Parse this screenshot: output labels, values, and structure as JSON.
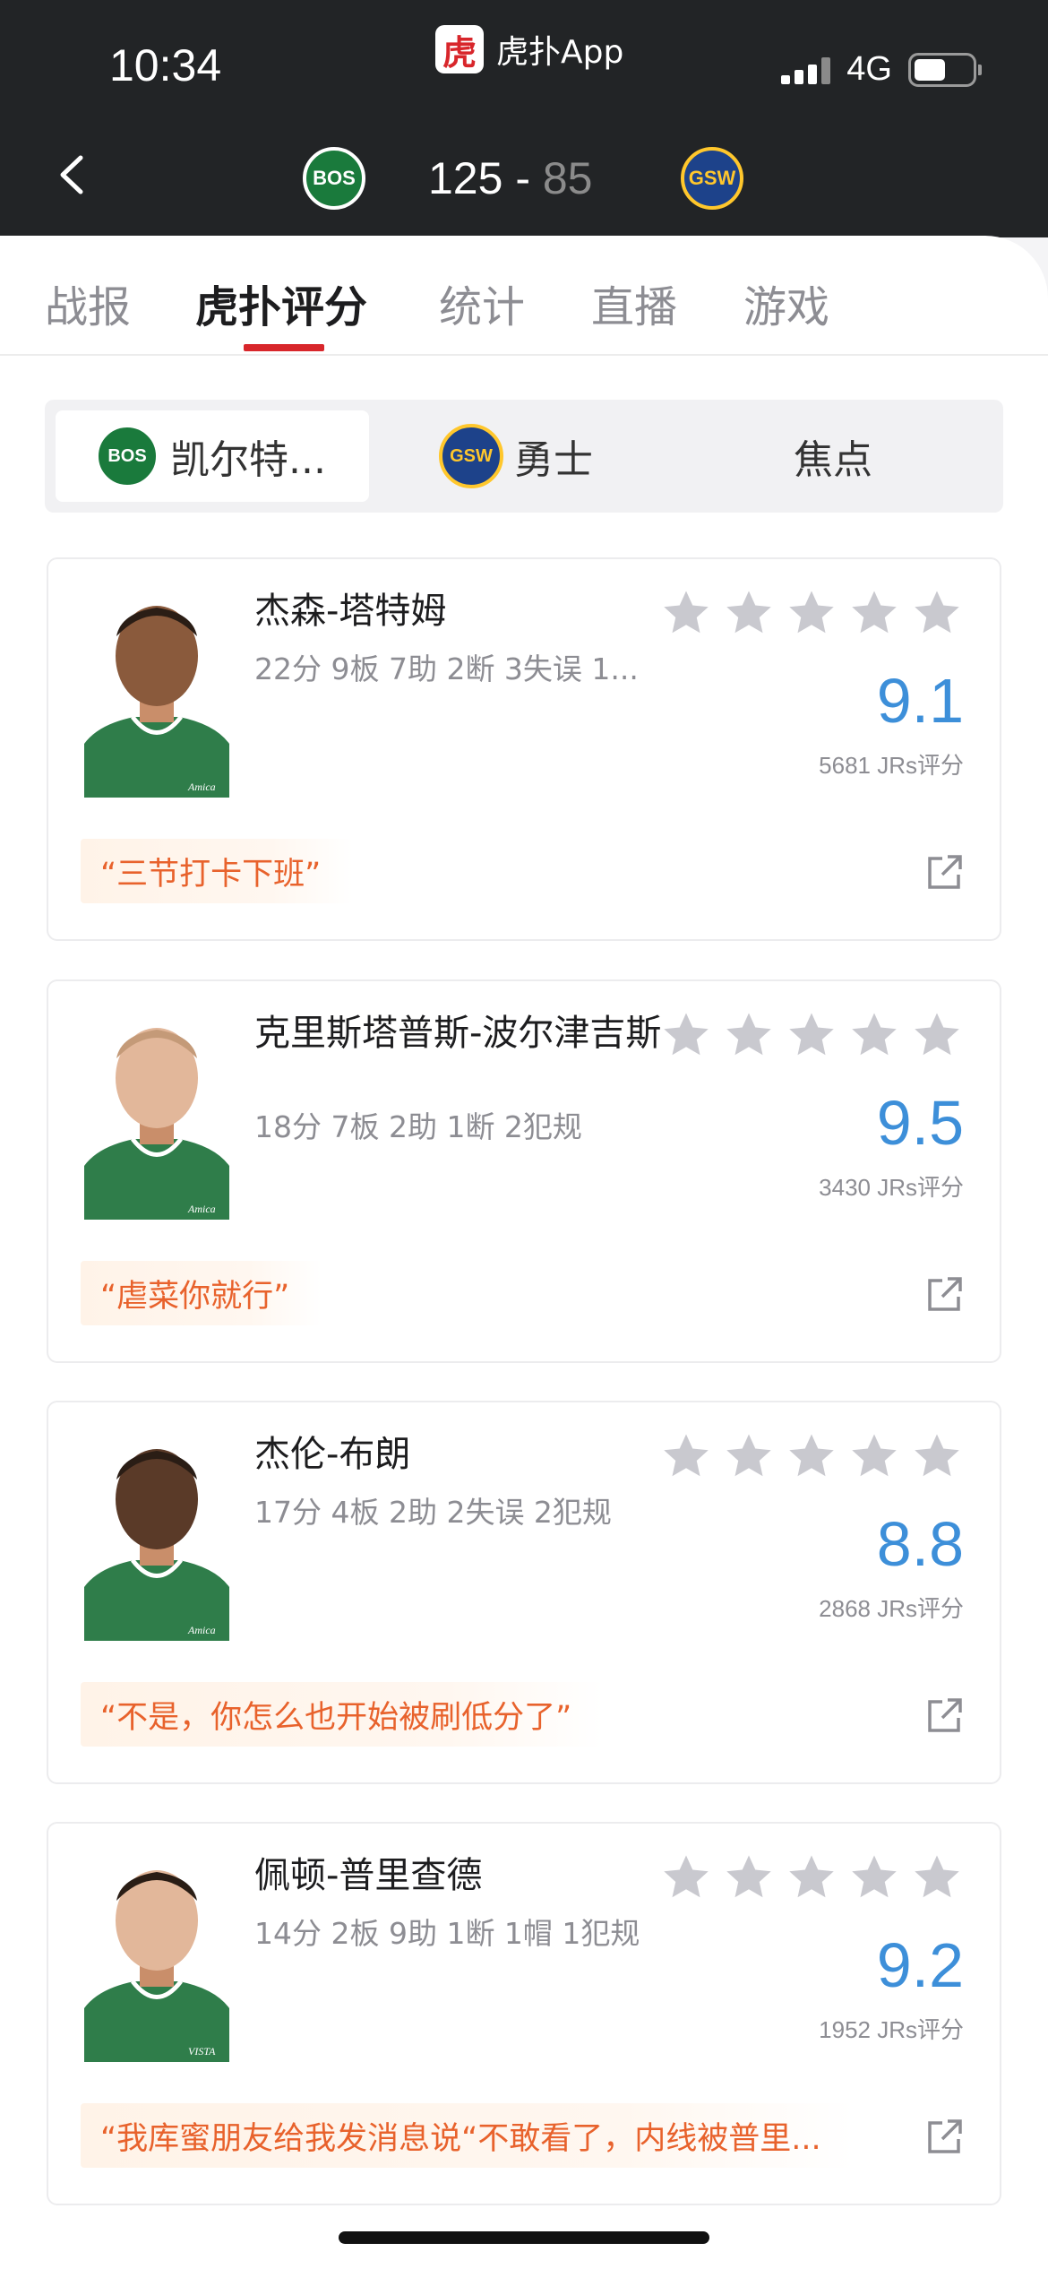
{
  "status_bar": {
    "time": "10:34",
    "app_name": "虎扑App",
    "app_logo_char": "虎",
    "network": "4G"
  },
  "header": {
    "home_team_logo": "BOS",
    "away_team_logo": "GSW",
    "home_score": "125",
    "score_sep": " - ",
    "away_score": "85"
  },
  "tabs": [
    {
      "label": "战报"
    },
    {
      "label": "虎扑评分"
    },
    {
      "label": "统计"
    },
    {
      "label": "直播"
    },
    {
      "label": "游戏"
    }
  ],
  "segments": [
    {
      "label": "凯尔特...",
      "logo": "BOS"
    },
    {
      "label": "勇士",
      "logo": "GSW"
    },
    {
      "label": "焦点"
    }
  ],
  "players": [
    {
      "name": "杰森-塔特姆",
      "stats": "22分 9板 7助 2断 3失误 1...",
      "rating": "9.1",
      "votes": "5681 JRs评分",
      "quote": "“三节打卡下班”"
    },
    {
      "name": "克里斯塔普斯-波尔津吉斯",
      "stats": "18分 7板 2助 1断 2犯规",
      "rating": "9.5",
      "votes": "3430 JRs评分",
      "quote": "“虐菜你就行”"
    },
    {
      "name": "杰伦-布朗",
      "stats": "17分 4板 2助 2失误 2犯规",
      "rating": "8.8",
      "votes": "2868 JRs评分",
      "quote": "“不是，你怎么也开始被刷低分了”"
    },
    {
      "name": "佩顿-普里查德",
      "stats": "14分 2板 9助 1断 1帽 1犯规",
      "rating": "9.2",
      "votes": "1952 JRs评分",
      "quote": "“我库蜜朋友给我发消息说“不敢看了，内线被普里..."
    }
  ],
  "colors": {
    "accent_red": "#d8262b",
    "rating_blue": "#3d8fd9",
    "quote_orange": "#e8622c",
    "header_dark": "#222426",
    "bos_green": "#1a7a3c",
    "gsw_blue": "#1d428a",
    "gsw_gold": "#ffc72c"
  },
  "icons": {
    "back": "chevron-left-icon",
    "star": "star-icon",
    "share": "share-external-icon"
  }
}
